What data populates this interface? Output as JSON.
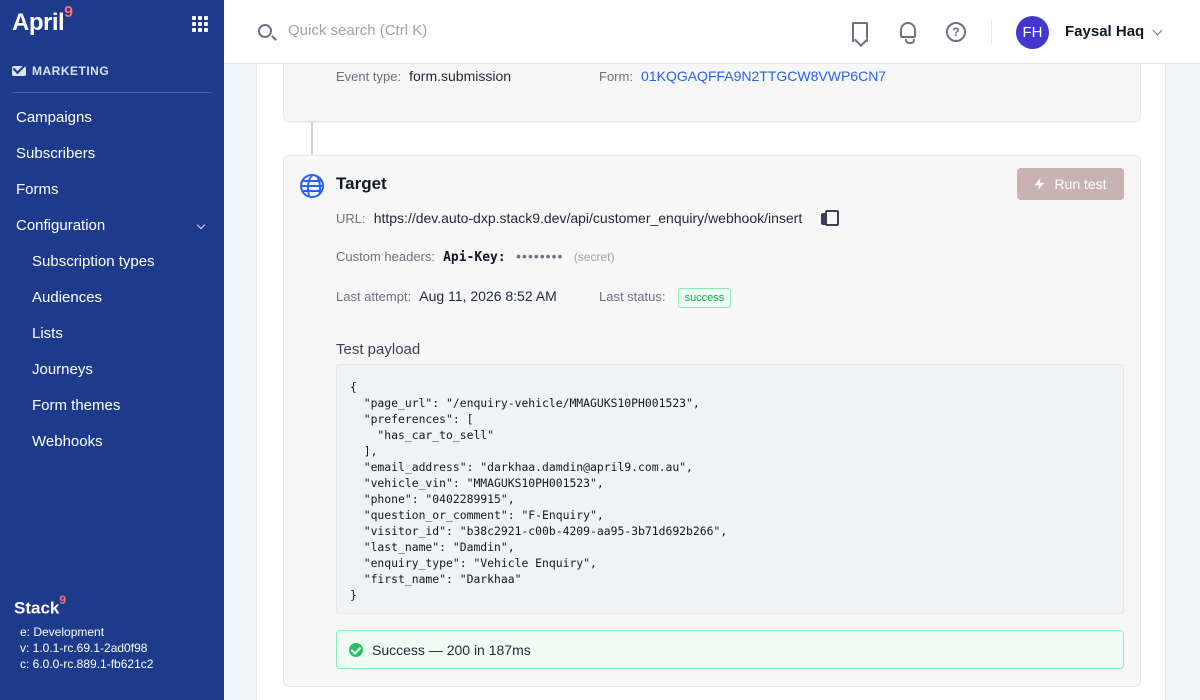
{
  "sidebar": {
    "logo": "April",
    "logo_mark": "9",
    "section_title": "MARKETING",
    "items": [
      {
        "label": "Campaigns"
      },
      {
        "label": "Subscribers"
      },
      {
        "label": "Forms"
      },
      {
        "label": "Configuration"
      },
      {
        "label": "Subscription types"
      },
      {
        "label": "Audiences"
      },
      {
        "label": "Lists"
      },
      {
        "label": "Journeys"
      },
      {
        "label": "Form themes"
      },
      {
        "label": "Webhooks"
      }
    ],
    "footer_logo": "Stack",
    "footer_logo_mark": "9",
    "env": "e: Development",
    "version": "v: 1.0.1-rc.69.1-2ad0f98",
    "core": "c: 6.0.0-rc.889.1-fb621c2"
  },
  "topbar": {
    "search_placeholder": "Quick search (Ctrl K)",
    "user_initials": "FH",
    "user_name": "Faysal Haq",
    "help_glyph": "?"
  },
  "trigger": {
    "event_type_label": "Event type",
    "event_type_value": "form.submission",
    "form_label": "Form",
    "form_value": "01KQGAQFFA9N2TTGCW8VWP6CN7"
  },
  "target": {
    "title": "Target",
    "run_test_label": "Run test",
    "url_label": "URL",
    "url_value": "https://dev.auto-dxp.stack9.dev/api/customer_enquiry/webhook/insert",
    "headers_label": "Custom headers",
    "header_key": "Api-Key:",
    "header_secret": "••••••••",
    "header_secret_note": "(secret)",
    "last_attempt_label": "Last attempt",
    "last_attempt_value": "Aug 11, 2026 8:52 AM",
    "last_status_label": "Last status",
    "last_status_value": "success",
    "payload_label": "Test payload",
    "payload": "{\n  \"page_url\": \"/enquiry-vehicle/MMAGUKS10PH001523\",\n  \"preferences\": [\n    \"has_car_to_sell\"\n  ],\n  \"email_address\": \"darkhaa.damdin@april9.com.au\",\n  \"vehicle_vin\": \"MMAGUKS10PH001523\",\n  \"phone\": \"0402289915\",\n  \"question_or_comment\": \"F-Enquiry\",\n  \"visitor_id\": \"b38c2921-c00b-4209-aa95-3b71d692b266\",\n  \"last_name\": \"Damdin\",\n  \"enquiry_type\": \"Vehicle Enquiry\",\n  \"first_name\": \"Darkhaa\"\n}",
    "result": "Success — 200 in 187ms"
  },
  "colors": {
    "sidebar_bg": "#1e3a8a",
    "accent": "#2563eb",
    "success": "#22c55e",
    "run_button": "#cbb2b2"
  },
  "icons": [
    "grid-icon",
    "mail-icon",
    "chevron-down-icon",
    "search-icon",
    "bookmark-icon",
    "bell-icon",
    "help-icon",
    "globe-icon",
    "bolt-icon",
    "copy-icon",
    "check-circle-icon"
  ]
}
